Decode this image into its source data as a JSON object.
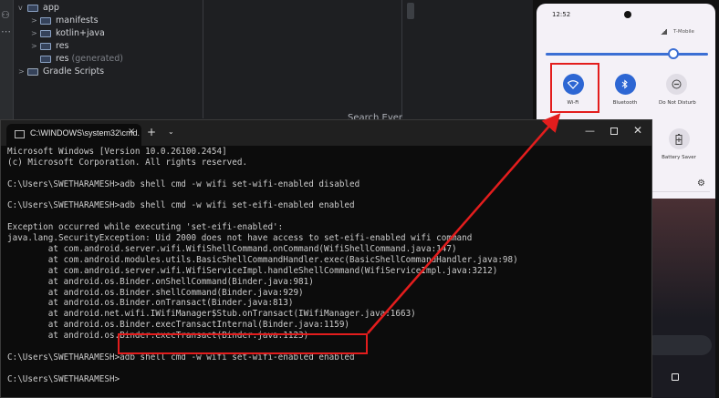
{
  "ide": {
    "tree": [
      {
        "label": "app",
        "indent": 0,
        "chevron": "v"
      },
      {
        "label": "manifests",
        "indent": 1,
        "chevron": ">"
      },
      {
        "label": "kotlin+java",
        "indent": 1,
        "chevron": ">"
      },
      {
        "label": "res",
        "indent": 1,
        "chevron": ">"
      },
      {
        "label": "res",
        "suffix": "(generated)",
        "indent": 1,
        "chevron": ""
      },
      {
        "label": "Gradle Scripts",
        "indent": 0,
        "chevron": ">"
      }
    ],
    "search_label": "Search Ever"
  },
  "phone": {
    "time": "12:52",
    "carrier": "T-Mobile",
    "tiles": [
      {
        "label": "Wi-Fi",
        "state": "on",
        "icon": "wifi-icon"
      },
      {
        "label": "Bluetooth",
        "state": "on",
        "icon": "bluetooth-icon"
      },
      {
        "label": "Do Not Disturb",
        "state": "off",
        "icon": "do-not-disturb-icon"
      },
      {
        "label": "Battery Saver",
        "state": "off",
        "icon": "battery-saver-icon"
      }
    ],
    "accent": "#2d66d3"
  },
  "terminal": {
    "tab_title": "C:\\WINDOWS\\system32\\cmd.",
    "close_glyph": "×",
    "new_tab_glyph": "+",
    "dropdown_glyph": "⌄",
    "minimize_glyph": "—",
    "close_window_glyph": "✕",
    "lines": [
      "Microsoft Windows [Version 10.0.26100.2454]",
      "(c) Microsoft Corporation. All rights reserved.",
      "",
      "C:\\Users\\SWETHARAMESH>adb shell cmd -w wifi set-wifi-enabled disabled",
      "",
      "C:\\Users\\SWETHARAMESH>adb shell cmd -w wifi set-eifi-enabled enabled",
      "",
      "Exception occurred while executing 'set-eifi-enabled':",
      "java.lang.SecurityException: Uid 2000 does not have access to set-eifi-enabled wifi command",
      "        at com.android.server.wifi.WifiShellCommand.onCommand(WifiShellCommand.java:147)",
      "        at com.android.modules.utils.BasicShellCommandHandler.exec(BasicShellCommandHandler.java:98)",
      "        at com.android.server.wifi.WifiServiceImpl.handleShellCommand(WifiServiceImpl.java:3212)",
      "        at android.os.Binder.onShellCommand(Binder.java:981)",
      "        at android.os.Binder.shellCommand(Binder.java:929)",
      "        at android.os.Binder.onTransact(Binder.java:813)",
      "        at android.net.wifi.IWifiManager$Stub.onTransact(IWifiManager.java:1663)",
      "        at android.os.Binder.execTransactInternal(Binder.java:1159)",
      "        at android.os.Binder.execTransact(Binder.java:1123)",
      "",
      "C:\\Users\\SWETHARAMESH>adb shell cmd -w wifi set-wifi-enabled enabled",
      "",
      "C:\\Users\\SWETHARAMESH>"
    ]
  },
  "annotation_color": "#e31d1d"
}
